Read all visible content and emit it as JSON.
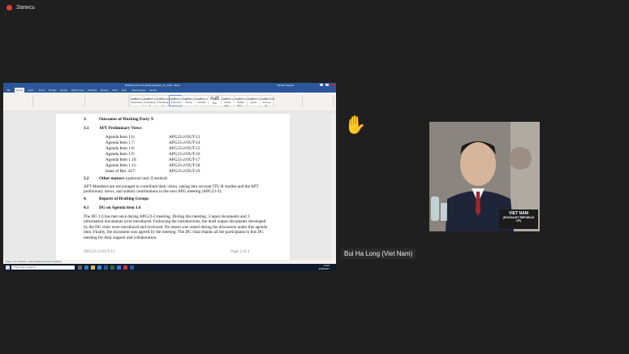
{
  "recording": {
    "label": "Запись"
  },
  "word": {
    "title": "RFGM-2-OUT-12_Meeting Report_v1_ANA - Word",
    "user": "Vietnam Person",
    "tabs": [
      "File",
      "Home",
      "Insert",
      "Draw",
      "Design",
      "Layout",
      "References",
      "Mailings",
      "Review",
      "View",
      "Help",
      "Table Design",
      "Layout"
    ],
    "active_tab": "Home",
    "search_placeholder": "Search",
    "styles": [
      {
        "sample": "AaBbCcD",
        "name": "Emphasis"
      },
      {
        "sample": "AaBbCcD",
        "name": "¶ Heading 1"
      },
      {
        "sample": "AaBbCcD",
        "name": "¶ Heading 2"
      },
      {
        "sample": "AaBbCcD",
        "name": "¶ Normal"
      },
      {
        "sample": "AaBbCc",
        "name": "Strong"
      },
      {
        "sample": "AaBbCcD",
        "name": "Subtitle"
      },
      {
        "sample": "AaB",
        "name": "Title"
      },
      {
        "sample": "AaBbCcD",
        "name": "Subtle Em..."
      },
      {
        "sample": "AaBbCcD",
        "name": "Subtle Em..."
      },
      {
        "sample": "AaBbCcD",
        "name": "Quote"
      },
      {
        "sample": "AaBbCcD",
        "name": "Intense Q..."
      }
    ],
    "status": "Page 2 of 4   Words: 1,012   English (United Kingdom)"
  },
  "document": {
    "sec3": {
      "num": "3.",
      "title": "Outcomes of Working Party X"
    },
    "sec31": {
      "num": "3.1",
      "title": "APT Preliminary Views"
    },
    "agenda": [
      {
        "item": "Agenda Item 1.6:",
        "code": "APG23-2/OUT-13"
      },
      {
        "item": "Agenda Item 1.7:",
        "code": "APG23-2/OUT-14"
      },
      {
        "item": "Agenda Item 1.8:",
        "code": "APG23-2/OUT-15"
      },
      {
        "item": "Agenda Item 1.9:",
        "code": "APG23-2/OUT-16"
      },
      {
        "item": "Agenda Item 1.10:",
        "code": "APG23-2/OUT-17"
      },
      {
        "item": "Agenda Item 1.11:",
        "code": "APG23-2/OUT-18"
      },
      {
        "item": "Issue of Res. 427:",
        "code": "APG23-2/OUT-19"
      }
    ],
    "sec32": {
      "num": "3.2",
      "title": "Other matters",
      "note": "(optional only if needed)"
    },
    "sec32_text": "APT Members are encouraged to contribute their views, taking into account ITU-R studies and the APT preliminary views, and submit contributions to the next APG meeting (APG23-3).",
    "sec4": {
      "num": "4.",
      "title": "Reports of Drafting Groups"
    },
    "sec41": {
      "num": "4.1",
      "title": "DG on Agenda item 1.6"
    },
    "sec41_text": "The DG 1.6 has met once during APG23-2 meeting. During this meeting, 3 input documents and 3 information documents were introduced. Following the introductions, the draft output documents developed by the DG chair were introduced and reviewed. No issues was raised during the discussion under this agenda item. Finally, the document was agreed by the meeting. The DG chair thanks all the participants to this DG meeting for their support and collaboration.",
    "footer_left": "APG23-2/OUT-12",
    "footer_right": "Page 2 of 4"
  },
  "taskbar": {
    "search": "Type here to search",
    "time": "14:45",
    "date": "2/28/2017"
  },
  "participant": {
    "name": "Bui Ha Long (Viet Nam)",
    "placard_line1": "VIET NAM",
    "placard_line2": "(SOCIALIST REPUBLIC OF)"
  }
}
